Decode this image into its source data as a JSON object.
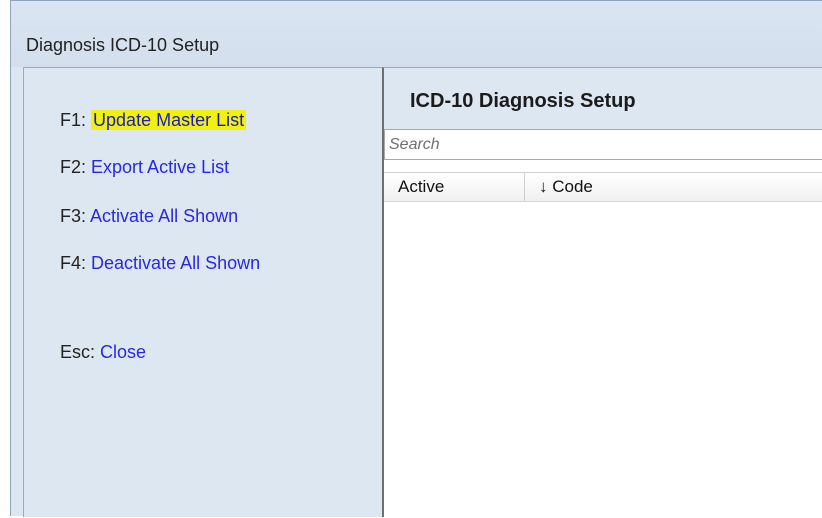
{
  "window": {
    "title": "Diagnosis ICD-10 Setup"
  },
  "hotkeys": [
    {
      "key": "F1:",
      "action": "Update Master List",
      "highlighted": true
    },
    {
      "key": "F2:",
      "action": "Export Active List",
      "highlighted": false
    },
    {
      "key": "F3:",
      "action": "Activate All Shown",
      "highlighted": false
    },
    {
      "key": "F4:",
      "action": "Deactivate All Shown",
      "highlighted": false
    },
    {
      "key": "Esc:",
      "action": "Close",
      "highlighted": false
    }
  ],
  "main": {
    "title": "ICD-10 Diagnosis Setup",
    "search": {
      "placeholder": "Search",
      "value": ""
    },
    "table": {
      "columns": [
        "Active",
        "↓ Code"
      ],
      "sort_column": "Code",
      "sort_direction": "descending",
      "rows": []
    }
  },
  "colors": {
    "window_bg": "#dbe6f1",
    "link_blue": "#2727e6",
    "highlight_yellow": "#f1f20b"
  }
}
